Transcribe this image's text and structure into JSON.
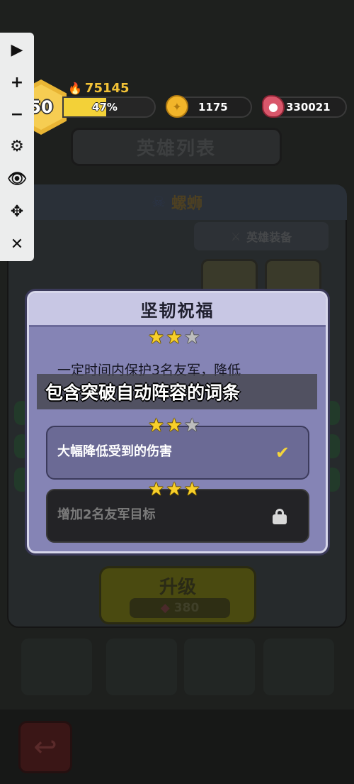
{
  "hud": {
    "level": "50",
    "power": "75145",
    "xp_percent_label": "47%",
    "xp_fraction": 0.47,
    "coins": "1175",
    "meat": "330021",
    "icons": [
      "flame-icon",
      "coin-icon",
      "meat-icon"
    ]
  },
  "toolbar": {
    "items": [
      {
        "name": "play-icon",
        "glyph": "▶"
      },
      {
        "name": "zoom-in-icon",
        "glyph": "+"
      },
      {
        "name": "zoom-out-icon",
        "glyph": "−"
      },
      {
        "name": "settings-icon",
        "glyph": "⚙"
      },
      {
        "name": "eye-icon",
        "glyph": "👁"
      },
      {
        "name": "move-icon",
        "glyph": "✥"
      },
      {
        "name": "close-icon",
        "glyph": "✕"
      }
    ]
  },
  "background": {
    "page_title": "英雄列表",
    "hero_name": "螺蛳",
    "equipment_label": "英雄装备",
    "upgrade_label": "升级",
    "upgrade_cost": "380",
    "back_icon": "back-arrow-icon"
  },
  "dialog": {
    "title": "坚韧祝福",
    "tier1_stars": 2,
    "description": "一定时间内保护3名友军，降低",
    "options": [
      {
        "label": "大幅降低受到的伤害",
        "stars": 2,
        "state": "selected"
      },
      {
        "label": "增加2名友军目标",
        "stars": 3,
        "state": "locked"
      }
    ]
  },
  "caption": {
    "text": "包含突破自动阵容的词条"
  },
  "colors": {
    "dialog_bg": "#8584b5",
    "star": "#f7cf2a",
    "check": "#f4d43a",
    "xp_fill": "#f3d138"
  }
}
